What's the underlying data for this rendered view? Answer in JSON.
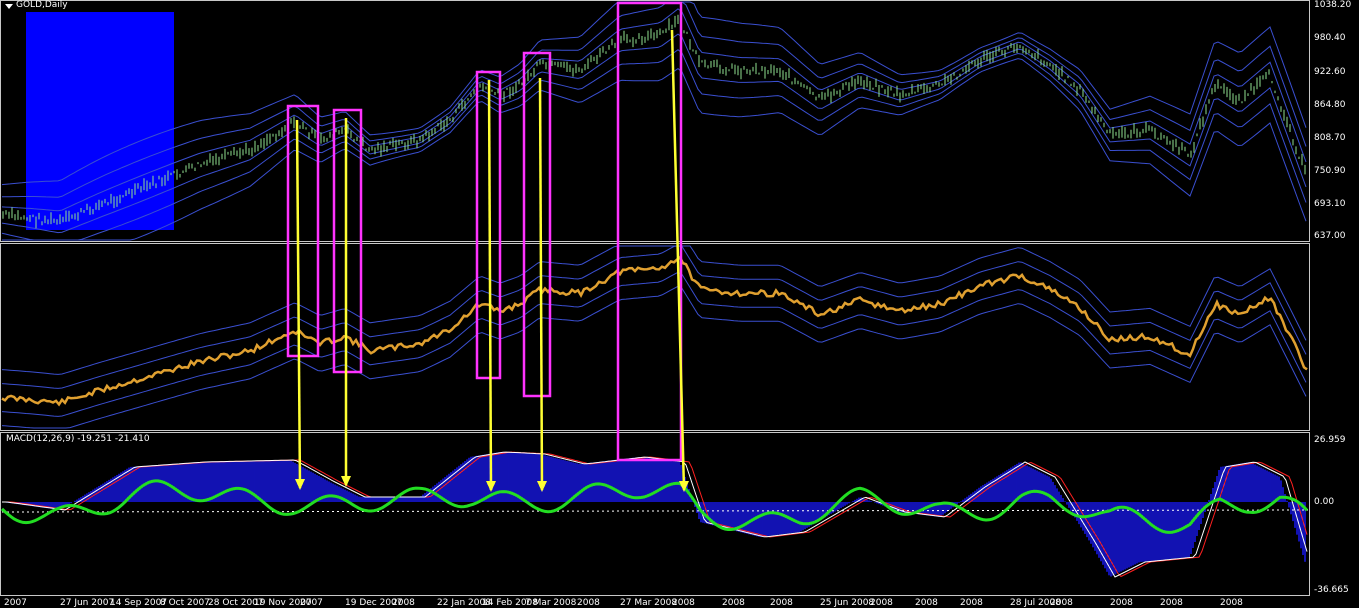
{
  "window": {
    "symbol_label": "GOLD,Daily",
    "dropdown_icon": "triangle-down-icon"
  },
  "price_axis": [
    "1038.20",
    "980.40",
    "922.60",
    "864.80",
    "808.70",
    "750.90",
    "693.10",
    "637.00"
  ],
  "macd": {
    "header": "MACD(12,26,9) -19.251 -21.410",
    "axis": [
      "26.959",
      "0.00",
      "-36.665"
    ]
  },
  "time_axis": [
    "2007",
    "27 Jun 2007",
    "14 Sep 2007",
    "8 Oct 2007",
    "28 Oct 2007",
    "19 Nov 2007",
    "2007",
    "19 Dec 2007",
    "2008",
    "22 Jan 2008",
    "14 Feb 2008",
    "7 Mar 2008",
    "2008",
    "27 Mar 2008",
    "2008",
    "2008",
    "2008",
    "25 Jun 2008",
    "2008",
    "2008",
    "2008",
    "28 Jul 2008",
    "2008",
    "2008",
    "2008",
    "2008"
  ],
  "colors": {
    "background": "#000000",
    "bars": "#8fe08f",
    "bands": "#3a4fd0",
    "orange_line": "#e0a030",
    "macd_hist": "#1a1aff",
    "macd_green": "#22dd22",
    "signal_red": "#ff2020",
    "highlight_box": "#ff33ff",
    "arrow": "#ffff33",
    "blue_block": "#0000ff"
  }
}
